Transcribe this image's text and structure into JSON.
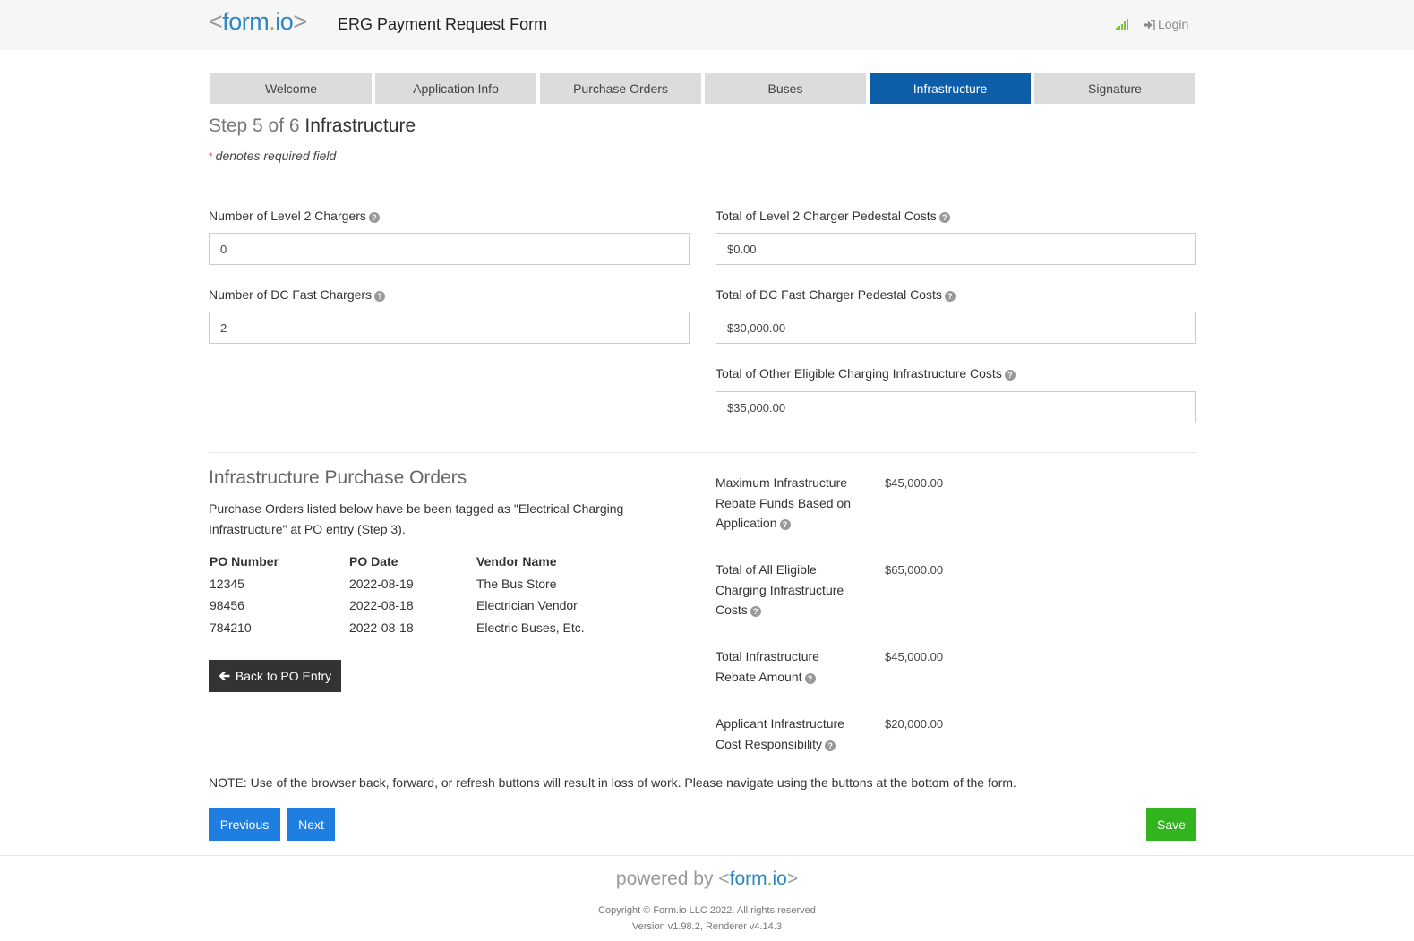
{
  "header": {
    "brand_open": "<",
    "brand_form": "form",
    "brand_dot": ".",
    "brand_io": "io",
    "brand_close": ">",
    "title": "ERG Payment Request Form",
    "login_label": "Login",
    "signal_icon": "signal-icon",
    "login_icon": "sign-in-icon"
  },
  "tabs": [
    {
      "label": "Welcome"
    },
    {
      "label": "Application Info"
    },
    {
      "label": "Purchase Orders"
    },
    {
      "label": "Buses"
    },
    {
      "label": "Infrastructure",
      "active": true
    },
    {
      "label": "Signature"
    }
  ],
  "step": {
    "prefix": "Step 5 of 6",
    "title": "Infrastructure"
  },
  "required_note": {
    "star": "*",
    "text": "denotes required field"
  },
  "fields": {
    "level2_count": {
      "label": "Number of Level 2 Chargers",
      "value": "0"
    },
    "level2_cost": {
      "label": "Total of Level 2 Charger Pedestal Costs",
      "value": "$0.00"
    },
    "dc_count": {
      "label": "Number of DC Fast Chargers",
      "value": "2"
    },
    "dc_cost": {
      "label": "Total of DC Fast Charger Pedestal Costs",
      "value": "$30,000.00"
    },
    "other_cost": {
      "label": "Total of Other Eligible Charging Infrastructure Costs",
      "value": "$35,000.00"
    }
  },
  "purchase_orders": {
    "title": "Infrastructure Purchase Orders",
    "description": "Purchase Orders listed below have be been tagged as \"Electrical Charging Infrastructure\" at PO entry (Step 3).",
    "columns": [
      "PO Number",
      "PO Date",
      "Vendor Name"
    ],
    "rows": [
      [
        "12345",
        "2022-08-19",
        "The Bus Store"
      ],
      [
        "98456",
        "2022-08-18",
        "Electrician Vendor"
      ],
      [
        "784210",
        "2022-08-18",
        "Electric Buses, Etc."
      ]
    ],
    "back_button": "Back to PO Entry"
  },
  "summary": [
    {
      "label": "Maximum Infrastructure Rebate Funds Based on Application",
      "value": "$45,000.00"
    },
    {
      "label": "Total of All Eligible Charging Infrastructure Costs",
      "value": "$65,000.00"
    },
    {
      "label": "Total Infrastructure Rebate Amount",
      "value": "$45,000.00"
    },
    {
      "label": "Applicant Infrastructure Cost Responsibility",
      "value": "$20,000.00"
    }
  ],
  "note": "NOTE: Use of the browser back, forward, or refresh buttons will result in loss of work. Please navigate using the buttons at the bottom of the form.",
  "buttons": {
    "previous": "Previous",
    "next": "Next",
    "save": "Save"
  },
  "footer": {
    "powered_by": "powered by",
    "copyright": "Copyright © Form.io LLC 2022. All rights reserved",
    "version": "Version v1.98.2, Renderer v4.14.3"
  },
  "colors": {
    "active_tab": "#0d5ea8",
    "primary_button": "#1f7fe0",
    "save_button": "#32b41e",
    "brand_blue": "#2d87c5",
    "brand_green": "#7cc142"
  }
}
